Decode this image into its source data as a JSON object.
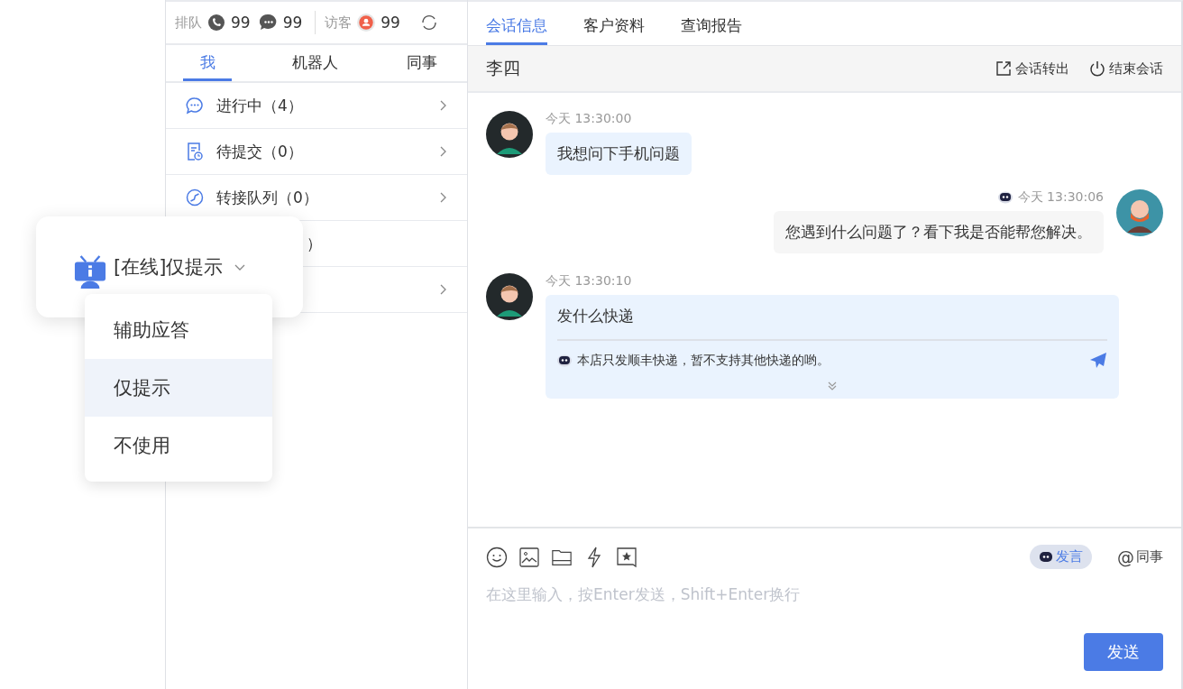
{
  "queue_bar": {
    "queue_label": "排队",
    "phone_count": "99",
    "chat_count": "99",
    "visitor_label": "访客",
    "visitor_count": "99"
  },
  "tabs": [
    {
      "label": "我",
      "selected": true
    },
    {
      "label": "机器人",
      "selected": false
    },
    {
      "label": "同事",
      "selected": false
    }
  ],
  "sessions": [
    {
      "kind": "chat",
      "label": "进行中（4）",
      "chevron": true
    },
    {
      "kind": "pending",
      "label": "待提交（0）",
      "chevron": true
    },
    {
      "kind": "transfer",
      "label": "转接队列（0）",
      "chevron": true
    },
    {
      "kind": "covered",
      "label": "）",
      "chevron": false
    },
    {
      "kind": "covered",
      "chevron": true
    }
  ],
  "robot_mode": {
    "status": "[在线]仅提示",
    "options": [
      {
        "label": "辅助应答",
        "selected": false
      },
      {
        "label": "仅提示",
        "selected": true
      },
      {
        "label": "不使用",
        "selected": false
      }
    ]
  },
  "chat_tabs": [
    {
      "label": "会话信息",
      "selected": true
    },
    {
      "label": "客户资料",
      "selected": false
    },
    {
      "label": "查询报告",
      "selected": false
    }
  ],
  "header": {
    "name": "李四",
    "actions": [
      {
        "kind": "transfer",
        "label": "会话转出"
      },
      {
        "kind": "end",
        "label": "结束会话"
      }
    ]
  },
  "messages": [
    {
      "kind": "customer",
      "time": "今天 13:30:00",
      "text": "我想问下手机问题"
    },
    {
      "kind": "agent",
      "bot": true,
      "time": "今天 13:30:06",
      "text": "您遇到什么问题了？看下我是否能帮您解决。"
    },
    {
      "kind": "customer",
      "time": "今天 13:30:10",
      "text": "发什么快递",
      "suggestion": "本店只发顺丰快递，暂不支持其他快递的哟。"
    }
  ],
  "composer": {
    "bot_button": "发言",
    "mention_symbol": "@",
    "mention": "同事",
    "placeholder": "在这里输入，按Enter发送，Shift+Enter换行",
    "send": "发送"
  }
}
